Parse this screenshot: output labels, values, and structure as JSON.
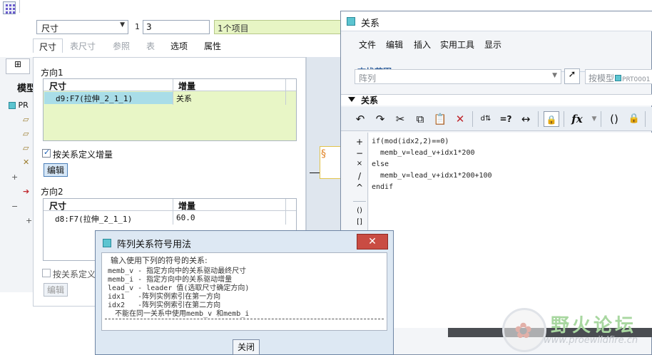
{
  "top": {
    "type_select": "尺寸",
    "count_label": "1",
    "count_value": "3",
    "items_field": "1个项目"
  },
  "tabs": [
    {
      "label": "尺寸",
      "state": "active"
    },
    {
      "label": "表尺寸",
      "state": "disabled"
    },
    {
      "label": "参照",
      "state": "disabled"
    },
    {
      "label": "表",
      "state": "disabled"
    },
    {
      "label": "选项",
      "state": "normal"
    },
    {
      "label": "属性",
      "state": "normal"
    }
  ],
  "tree": {
    "title": "模型",
    "root": "PR"
  },
  "dim_panel": {
    "direction1": {
      "label": "方向1",
      "headers": [
        "尺寸",
        "增量"
      ],
      "rows": [
        {
          "dimension": "d9:F7(拉伸_2_1_1)",
          "increment": "关系"
        }
      ],
      "checkbox_label": "按关系定义增量",
      "edit_button": "编辑"
    },
    "direction2": {
      "label": "方向2",
      "headers": [
        "尺寸",
        "增量"
      ],
      "rows": [
        {
          "dimension": "d8:F7(拉伸_2_1_1)",
          "increment": "60.0"
        }
      ],
      "checkbox_label": "按关系定义",
      "edit_button": "编辑"
    }
  },
  "relations": {
    "title": "关系",
    "menu": [
      "文件",
      "编辑",
      "插入",
      "实用工具",
      "显示"
    ],
    "find_scope_label": "查找范围",
    "scope_select": "阵列",
    "model_select": "按模型",
    "model_value": "PRT0001",
    "section_label": "关系",
    "ops": [
      "+",
      "−",
      "×",
      "/",
      "^",
      "()",
      "[]"
    ],
    "code": [
      "if(mod(idx2,2)==0)",
      "  memb_v=lead_v+idx1*200",
      "else",
      "  memb_v=lead_v+idx1*200+100",
      "endif"
    ],
    "toolbar_icons": [
      "undo-icon",
      "redo-icon",
      "cut-icon",
      "copy-icon",
      "paste-icon",
      "delete-icon",
      "switch-symbols-icon",
      "evaluate-icon",
      "measure-icon",
      "verify-icon",
      "function-icon",
      "brackets-icon",
      "sort-icon"
    ]
  },
  "symbol_dialog": {
    "title": "阵列关系符号用法",
    "lines": [
      "输入使用下列的符号的关系:",
      "memb_v - 指定方向中的关系驱动最终尺寸",
      "memb_i - 指定方向中的关系驱动增量",
      "lead_v - leader 值(选取尺寸确定方向)",
      "idx1   -阵列实例索引在第一方向",
      "idx2   -阵列实例索引在第二方向",
      "不能在同一关系中使用memb_v 和memb_i"
    ],
    "close_button": "关闭"
  },
  "watermark": {
    "cn": "野火论坛",
    "url": "www.proewildfire.cn"
  },
  "colors": {
    "accent_green": "#e8f6c6",
    "selection_blue": "#a9dde8",
    "close_red": "#c94c43",
    "section_blue": "#2e5d9a"
  }
}
